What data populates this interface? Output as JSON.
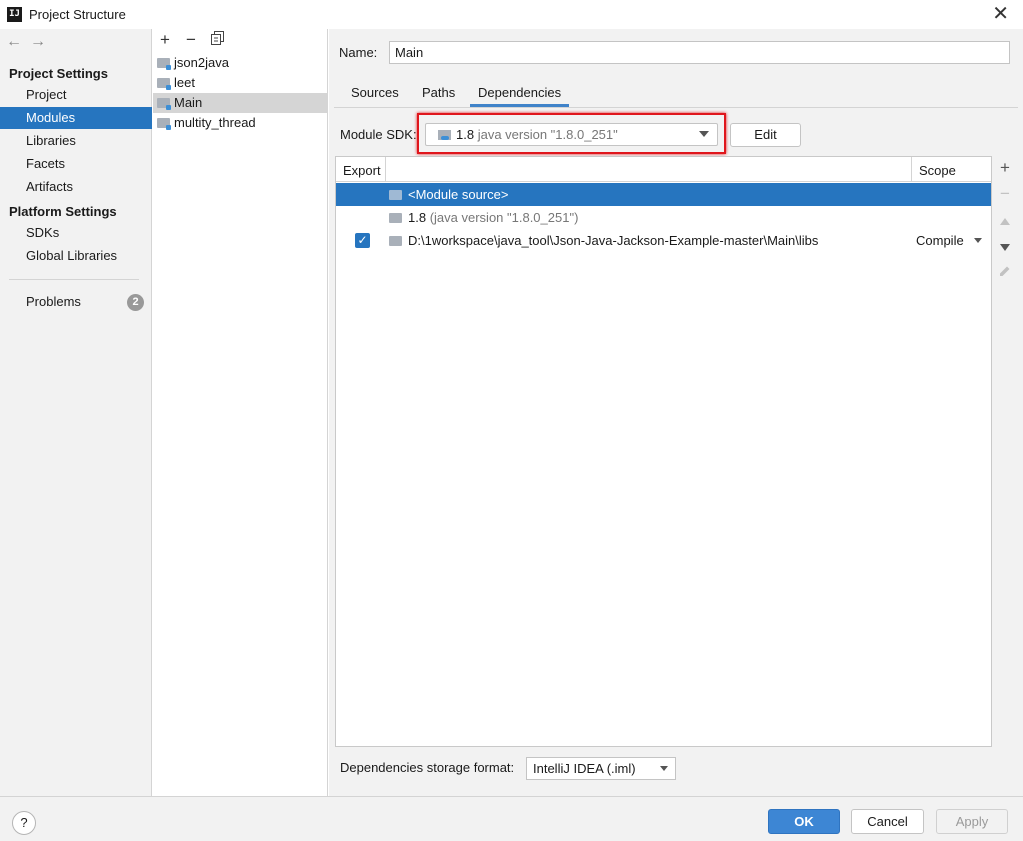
{
  "window": {
    "title": "Project Structure",
    "app_icon_text": "IJ"
  },
  "nav": {
    "back_icon": "arrow-left-icon",
    "forward_icon": "arrow-right-icon",
    "project_settings_header": "Project Settings",
    "project_settings_items": [
      {
        "label": "Project",
        "selected": false
      },
      {
        "label": "Modules",
        "selected": true
      },
      {
        "label": "Libraries",
        "selected": false
      },
      {
        "label": "Facets",
        "selected": false
      },
      {
        "label": "Artifacts",
        "selected": false
      }
    ],
    "platform_settings_header": "Platform Settings",
    "platform_settings_items": [
      {
        "label": "SDKs"
      },
      {
        "label": "Global Libraries"
      }
    ],
    "problems_label": "Problems",
    "problems_count": "2"
  },
  "modules": {
    "toolbar": {
      "add": "+",
      "remove": "−",
      "copy_icon": "copy-icon"
    },
    "items": [
      {
        "label": "json2java",
        "selected": false
      },
      {
        "label": "leet",
        "selected": false
      },
      {
        "label": "Main",
        "selected": true
      },
      {
        "label": "multity_thread",
        "selected": false
      }
    ]
  },
  "detail": {
    "name_label": "Name:",
    "name_value": "Main",
    "tabs": [
      {
        "label": "Sources",
        "active": false
      },
      {
        "label": "Paths",
        "active": false
      },
      {
        "label": "Dependencies",
        "active": true
      }
    ],
    "sdk_label": "Module SDK:",
    "sdk_version": "1.8",
    "sdk_detail": "java version \"1.8.0_251\"",
    "edit_label": "Edit",
    "highlight_color": "#e0161c"
  },
  "dependencies": {
    "columns": {
      "export": "Export",
      "scope": "Scope"
    },
    "rows": [
      {
        "name": "<Module source>",
        "detail": "",
        "exported": false,
        "scope": "",
        "selected": true
      },
      {
        "name": "1.8",
        "detail": "(java version \"1.8.0_251\")",
        "exported": false,
        "scope": "",
        "selected": false
      },
      {
        "name": "D:\\1workspace\\java_tool\\Json-Java-Jackson-Example-master\\Main\\libs",
        "detail": "",
        "exported": true,
        "scope": "Compile",
        "selected": false
      }
    ],
    "side_tools": [
      "add-icon",
      "remove-icon",
      "move-up-icon",
      "move-down-icon",
      "edit-icon"
    ],
    "storage_label": "Dependencies storage format:",
    "storage_value": "IntelliJ IDEA (.iml)"
  },
  "footer": {
    "help": "?",
    "ok": "OK",
    "cancel": "Cancel",
    "apply": "Apply"
  },
  "colors": {
    "selection": "#2675bf",
    "accent": "#4083c9",
    "highlight": "#e0161c"
  }
}
